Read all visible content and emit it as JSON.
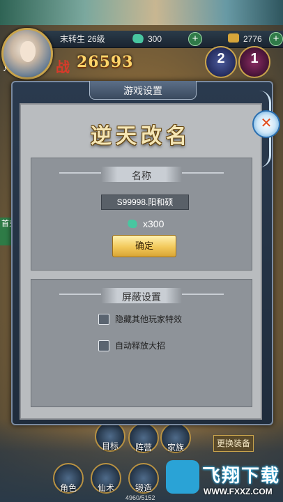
{
  "hud": {
    "level": "末转生 26级",
    "currency_a": "300",
    "currency_b": "2776",
    "power_label": "战",
    "power_value": "26593",
    "badge_a": "2",
    "badge_b": "1",
    "side_tag": "首充"
  },
  "dialog": {
    "title": "游戏设置",
    "hero_title": "逆天改名",
    "name_section": {
      "header": "名称",
      "name_value": "S99998.阳和硕",
      "cost": "x300",
      "confirm_label": "确定"
    },
    "shield_section": {
      "header": "屏蔽设置",
      "option_1": "隐藏其他玩家特效",
      "option_2": "自动释放大招"
    }
  },
  "bottom": {
    "mubiao": "目标",
    "zhenying": "阵营",
    "jiazu": "家族",
    "juese": "角色",
    "xianshu": "仙术",
    "duanzao": "锻造",
    "exp": "4960/5152",
    "change_equip": "更换装备"
  },
  "watermark": {
    "name": "飞翔下载",
    "url": "WWW.FXXZ.COM"
  },
  "colors": {
    "confirm_gold": "#f2c85a",
    "dialog_frame": "#2a3a4e",
    "panel_gray": "#8e9399"
  }
}
